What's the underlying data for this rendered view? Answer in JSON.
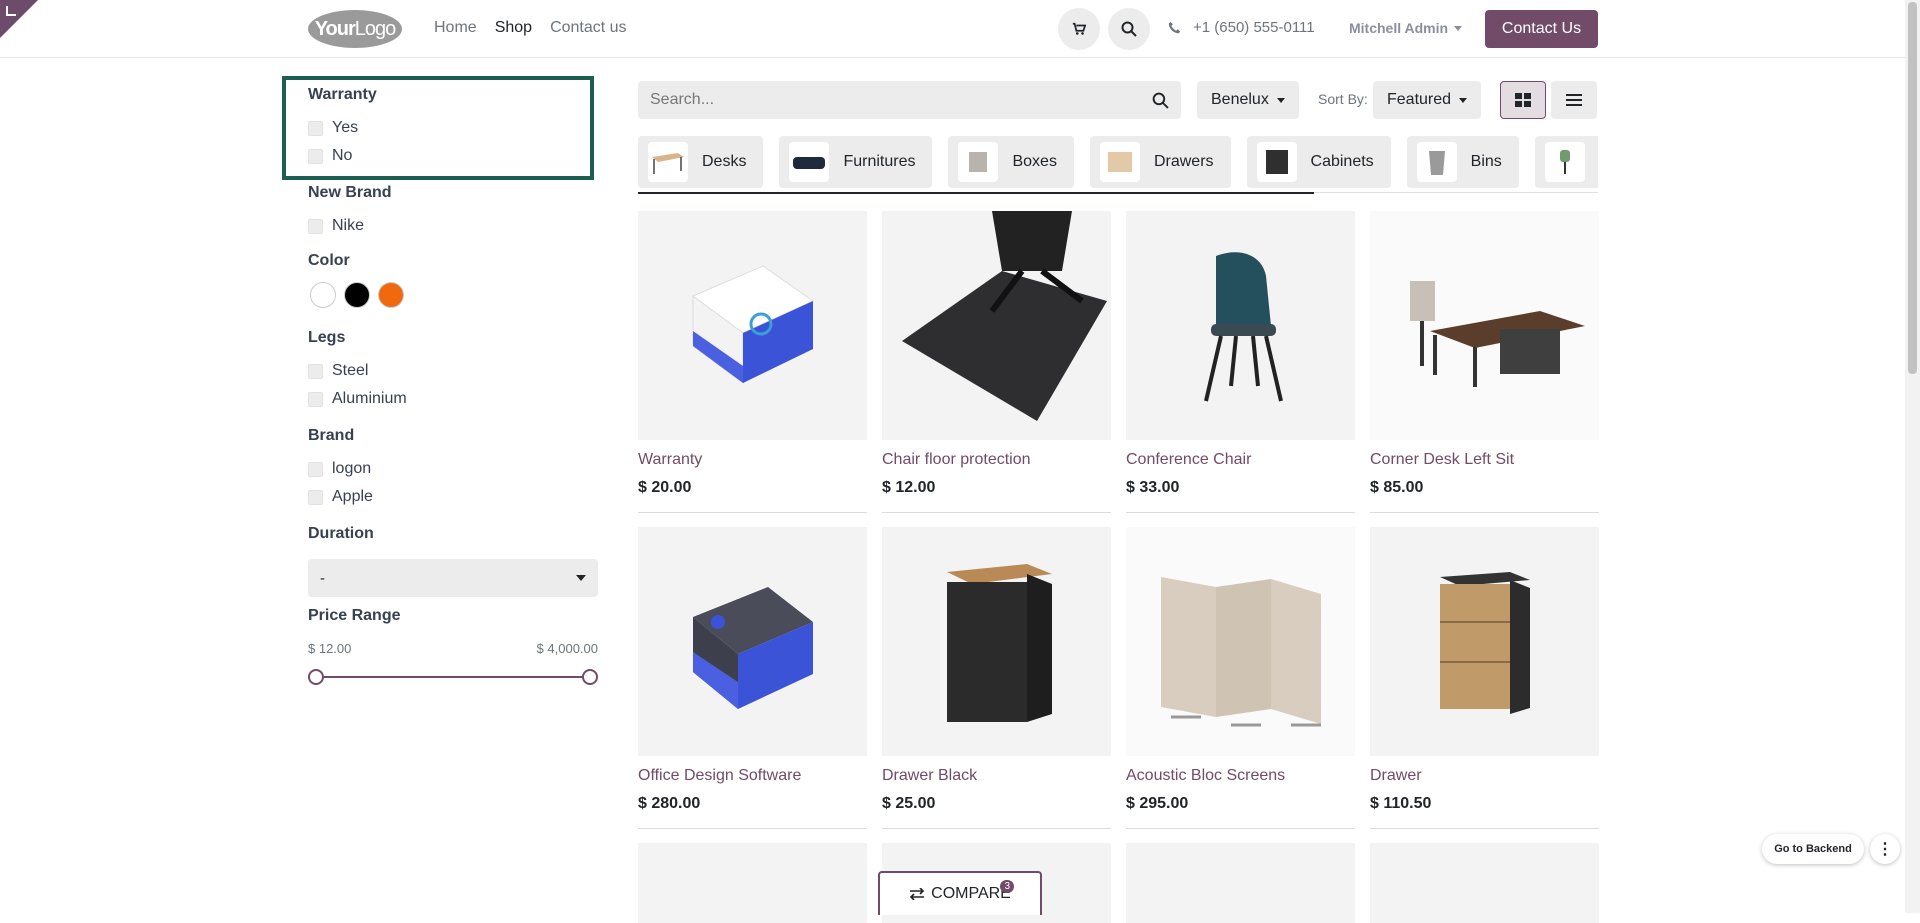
{
  "header": {
    "logo_main": "Your",
    "logo_sub": "Logo",
    "nav": [
      "Home",
      "Shop",
      "Contact us"
    ],
    "phone": "+1 (650) 555-0111",
    "user": "Mitchell Admin",
    "contact_button": "Contact Us"
  },
  "filters": {
    "warranty": {
      "title": "Warranty",
      "options": [
        "Yes",
        "No"
      ]
    },
    "new_brand": {
      "title": "New Brand",
      "options": [
        "Nike"
      ]
    },
    "color": {
      "title": "Color",
      "swatches": [
        "#ffffff",
        "#000000",
        "#f0690f"
      ]
    },
    "legs": {
      "title": "Legs",
      "options": [
        "Steel",
        "Aluminium"
      ]
    },
    "brand": {
      "title": "Brand",
      "options": [
        "logon",
        "Apple"
      ]
    },
    "duration": {
      "title": "Duration",
      "value": "-"
    },
    "price": {
      "title": "Price Range",
      "min": "$ 12.00",
      "max": "$ 4,000.00"
    }
  },
  "toolbar": {
    "search_placeholder": "Search...",
    "pricelist": "Benelux",
    "sort_label": "Sort By:",
    "sort_value": "Featured"
  },
  "categories": [
    "Desks",
    "Furnitures",
    "Boxes",
    "Drawers",
    "Cabinets",
    "Bins"
  ],
  "products": [
    {
      "name": "Warranty",
      "price": "$ 20.00"
    },
    {
      "name": "Chair floor protection",
      "price": "$ 12.00"
    },
    {
      "name": "Conference Chair",
      "price": "$ 33.00"
    },
    {
      "name": "Corner Desk Left Sit",
      "price": "$ 85.00"
    },
    {
      "name": "Office Design Software",
      "price": "$ 280.00"
    },
    {
      "name": "Drawer Black",
      "price": "$ 25.00"
    },
    {
      "name": "Acoustic Bloc Screens",
      "price": "$ 295.00"
    },
    {
      "name": "Drawer",
      "price": "$ 110.50"
    }
  ],
  "compare": {
    "label": "COMPARE",
    "count": "3"
  },
  "backend_button": "Go to Backend",
  "colors": {
    "accent": "#714b67",
    "highlight_border": "#1d5e52"
  }
}
